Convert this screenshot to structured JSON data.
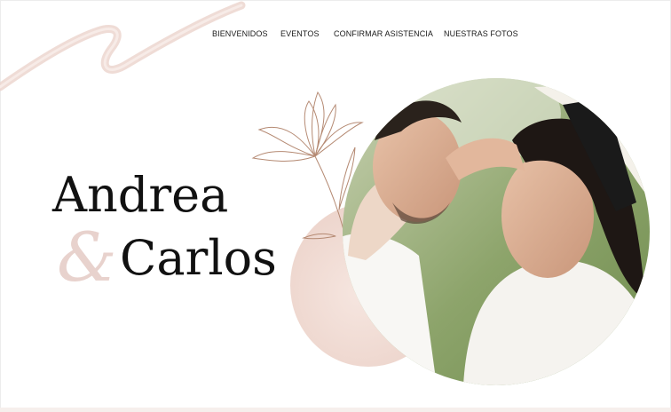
{
  "nav": {
    "items": [
      {
        "label": "BIENVENIDOS"
      },
      {
        "label": "EVENTOS"
      },
      {
        "label": "CONFIRMAR ASISTENCIA"
      },
      {
        "label": "NUESTRAS FOTOS"
      }
    ]
  },
  "hero": {
    "name_1": "Andrea",
    "ampersand": "&",
    "name_2": "Carlos"
  },
  "colors": {
    "blush": "#efd9d3",
    "text": "#111111"
  }
}
